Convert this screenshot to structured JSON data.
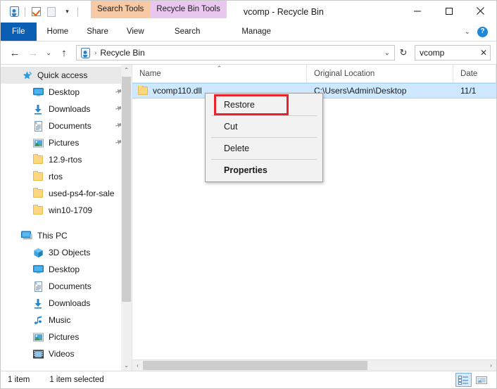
{
  "window": {
    "title": "vcomp - Recycle Bin",
    "minimize_label": "—",
    "maximize_label": "□",
    "close_label": "✕"
  },
  "quick_access_toolbar": {
    "items": [
      {
        "name": "recycle-bin-properties",
        "icon": "recycle-bin-icon"
      },
      {
        "name": "empty-recycle-bin",
        "icon": "checkbox-checked-icon"
      },
      {
        "name": "restore-all-items",
        "icon": "blank-page-icon"
      }
    ],
    "customize_caret": "▾"
  },
  "contextual_tabs": [
    {
      "label": "Search Tools",
      "color": "#f7c9a4"
    },
    {
      "label": "Recycle Bin Tools",
      "color": "#e9c8ef"
    }
  ],
  "ribbon": {
    "tabs": [
      {
        "label": "File",
        "selected": true
      },
      {
        "label": "Home",
        "selected": false
      },
      {
        "label": "Share",
        "selected": false
      },
      {
        "label": "View",
        "selected": false
      }
    ],
    "contextual_subtabs": [
      {
        "label": "Search"
      },
      {
        "label": "Manage"
      }
    ],
    "collapse_caret": "⌄",
    "help_label": "?"
  },
  "address_bar": {
    "back_label": "←",
    "forward_label": "→",
    "recent_caret": "⌄",
    "up_label": "↑",
    "path_icon": "recycle-bin-icon",
    "separator": "›",
    "crumb": "Recycle Bin",
    "dropdown_caret": "⌄",
    "refresh_label": "↻"
  },
  "search": {
    "value": "vcomp",
    "clear_label": "✕"
  },
  "sidebar": {
    "scroll_up": "⌃",
    "scroll_down": "⌄",
    "items": [
      {
        "label": "Quick access",
        "icon": "star-icon",
        "level": 0,
        "selected": true,
        "pinned": false
      },
      {
        "label": "Desktop",
        "icon": "desktop-icon",
        "level": 1,
        "selected": false,
        "pinned": true
      },
      {
        "label": "Downloads",
        "icon": "download-icon",
        "level": 1,
        "selected": false,
        "pinned": true
      },
      {
        "label": "Documents",
        "icon": "document-icon",
        "level": 1,
        "selected": false,
        "pinned": true
      },
      {
        "label": "Pictures",
        "icon": "pictures-icon",
        "level": 1,
        "selected": false,
        "pinned": true
      },
      {
        "label": "12.9-rtos",
        "icon": "folder-icon",
        "level": 1,
        "selected": false,
        "pinned": false
      },
      {
        "label": "rtos",
        "icon": "folder-icon",
        "level": 1,
        "selected": false,
        "pinned": false
      },
      {
        "label": "used-ps4-for-sale",
        "icon": "folder-icon",
        "level": 1,
        "selected": false,
        "pinned": false
      },
      {
        "label": "win10-1709",
        "icon": "folder-icon",
        "level": 1,
        "selected": false,
        "pinned": false
      },
      {
        "label": "",
        "icon": "spacer",
        "level": 0,
        "selected": false,
        "pinned": false
      },
      {
        "label": "This PC",
        "icon": "pc-icon",
        "level": 0,
        "selected": false,
        "pinned": false
      },
      {
        "label": "3D Objects",
        "icon": "3d-objects-icon",
        "level": 1,
        "selected": false,
        "pinned": false
      },
      {
        "label": "Desktop",
        "icon": "desktop-icon",
        "level": 1,
        "selected": false,
        "pinned": false
      },
      {
        "label": "Documents",
        "icon": "document-icon",
        "level": 1,
        "selected": false,
        "pinned": false
      },
      {
        "label": "Downloads",
        "icon": "download-icon",
        "level": 1,
        "selected": false,
        "pinned": false
      },
      {
        "label": "Music",
        "icon": "music-icon",
        "level": 1,
        "selected": false,
        "pinned": false
      },
      {
        "label": "Pictures",
        "icon": "pictures-icon",
        "level": 1,
        "selected": false,
        "pinned": false
      },
      {
        "label": "Videos",
        "icon": "videos-icon",
        "level": 1,
        "selected": false,
        "pinned": false
      }
    ]
  },
  "file_list": {
    "columns": [
      {
        "label": "Name",
        "sorted": true,
        "sort_caret": "⌃"
      },
      {
        "label": "Original Location",
        "sorted": false,
        "sort_caret": ""
      },
      {
        "label": "Date",
        "sorted": false,
        "sort_caret": ""
      }
    ],
    "rows": [
      {
        "name": "vcomp110.dll",
        "original_location": "C:\\Users\\Admin\\Desktop",
        "date": "11/1",
        "icon": "folder-icon",
        "selected": true
      }
    ],
    "h_scroll_left": "‹",
    "h_scroll_right": "›"
  },
  "context_menu": {
    "items": [
      {
        "label": "Restore",
        "bold": false,
        "highlighted": true
      },
      {
        "label": "Cut",
        "bold": false,
        "highlighted": false
      },
      {
        "label": "Delete",
        "bold": false,
        "highlighted": false
      },
      {
        "label": "Properties",
        "bold": true,
        "highlighted": false
      }
    ],
    "highlight_color": "#e8232a"
  },
  "status_bar": {
    "item_count": "1 item",
    "selection": "1 item selected",
    "views": [
      {
        "name": "details-view",
        "active": true
      },
      {
        "name": "large-icons-view",
        "active": false
      }
    ]
  }
}
